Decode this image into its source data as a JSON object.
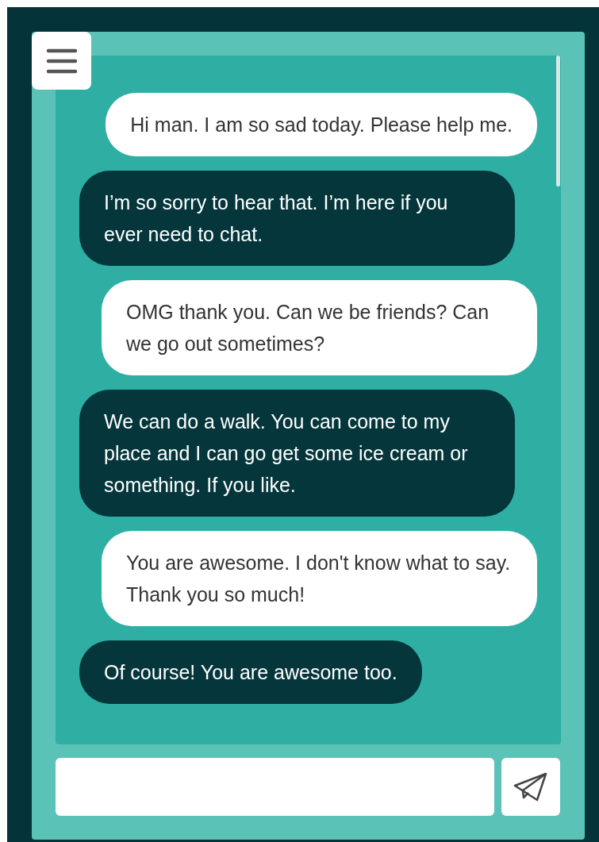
{
  "messages": [
    {
      "kind": "sent",
      "text": "Hi man. I am so sad today. Please help me."
    },
    {
      "kind": "received",
      "text": "I’m so sorry to hear that. I’m here if you ever need to chat."
    },
    {
      "kind": "sent",
      "text": "OMG thank you. Can we be friends? Can we go out sometimes?"
    },
    {
      "kind": "received",
      "text": "We can do a walk. You can come to my place and I can go get some ice cream or something. If you like."
    },
    {
      "kind": "sent",
      "text": "You are awesome. I don't know what to say. Thank you so much!"
    },
    {
      "kind": "received",
      "text": "Of course! You are awesome too."
    }
  ]
}
